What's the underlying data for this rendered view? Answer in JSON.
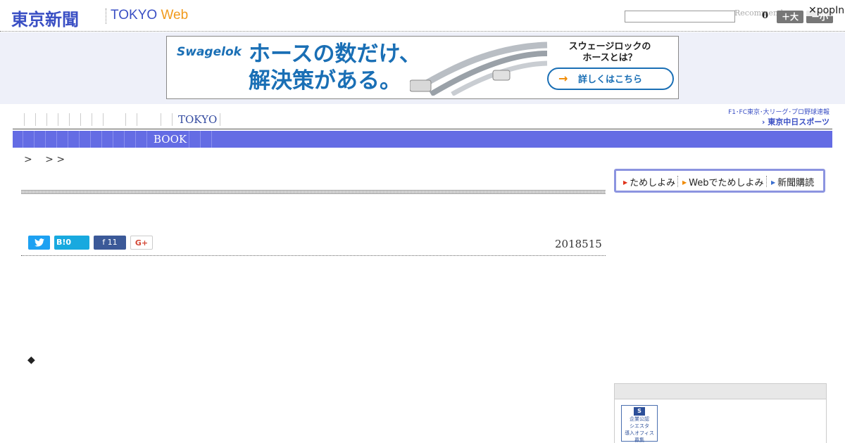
{
  "header": {
    "logo_jp": "東京新聞",
    "logo_tokyo": "TOKYO",
    "logo_web": "Web",
    "search_placeholder": "",
    "recommend": "Recommend",
    "count": "0",
    "btn_large": "＋大",
    "btn_small": "－小",
    "popin": "✕popIn"
  },
  "ad": {
    "brand": "Swagelok",
    "headline_1": "ホースの数だけ、",
    "headline_2": "解決策がある。",
    "question_1": "スウェージロックの",
    "question_2": "ホースとは？",
    "cta_arrow": "→",
    "cta": "詳しくはこちら"
  },
  "nav": {
    "tokyo": "TOKYO",
    "book": "BOOK",
    "chunichi_line1": "F1･FC東京･大リーグ･プロ野球速報",
    "chunichi_line2": "› 東京中日スポーツ"
  },
  "breadcrumb": ">　 > >",
  "trial": {
    "item1": "ためしよみ",
    "item2": "Webでためしよみ",
    "item3": "新聞購読"
  },
  "share": {
    "twitter_icon": "🐦",
    "hatena": "B!0",
    "facebook": "f  11",
    "gplus": "G+"
  },
  "date": "2018515",
  "diamond": "◆",
  "panel": {
    "icon_text_1": "企業公認",
    "icon_text_2": "シエスタ",
    "icon_text_3": "導入オフィス",
    "icon_text_4": "募集"
  },
  "colors": {
    "brand_blue": "#3a4fc4",
    "nav_bar": "#646ce4",
    "ad_blue": "#1a6fb5",
    "web_orange": "#f19a1c"
  }
}
